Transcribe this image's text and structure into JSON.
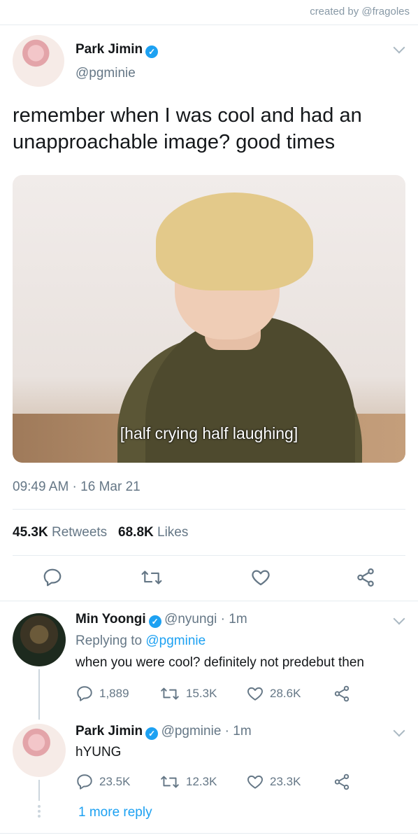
{
  "credit": "created by @fragoles",
  "tweet": {
    "author_name": "Park Jimin",
    "author_handle": "@pgminie",
    "text": "remember when I was cool and had an unapproachable image? good times",
    "image_caption": "[half crying half laughing]",
    "time": "09:49 AM",
    "date": "16 Mar 21",
    "retweets_count": "45.3K",
    "retweets_label": "Retweets",
    "likes_count": "68.8K",
    "likes_label": "Likes"
  },
  "replies": [
    {
      "author_name": "Min Yoongi",
      "author_handle": "@nyungi",
      "age": "1m",
      "replying_prefix": "Replying to",
      "replying_to": "@pgminie",
      "text": "when you were cool? definitely not predebut then",
      "reply_count": "1,889",
      "retweet_count": "15.3K",
      "like_count": "28.6K"
    },
    {
      "author_name": "Park Jimin",
      "author_handle": "@pgminie",
      "age": "1m",
      "text": "hYUNG",
      "reply_count": "23.5K",
      "retweet_count": "12.3K",
      "like_count": "23.3K"
    }
  ],
  "more_replies": "1 more reply",
  "colors": {
    "accent": "#1da1f2",
    "muted": "#657786",
    "divider": "#e6ecf0"
  }
}
